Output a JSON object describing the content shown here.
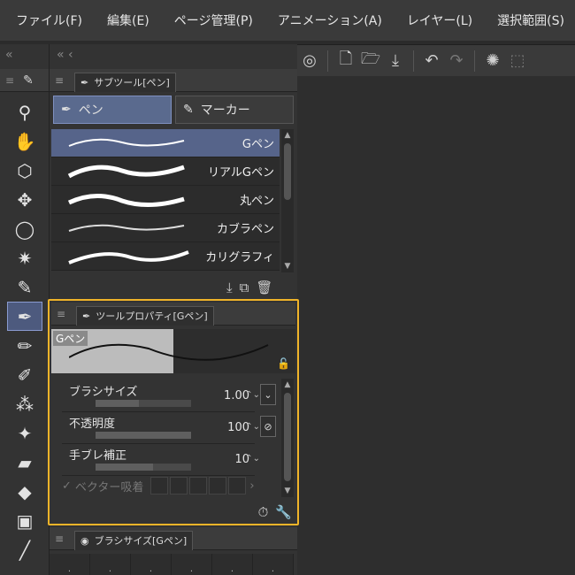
{
  "menu": [
    "ファイル(F)",
    "編集(E)",
    "ページ管理(P)",
    "アニメーション(A)",
    "レイヤー(L)",
    "選択範囲(S)",
    "表"
  ],
  "toolstrip": {
    "collapse": "«",
    "tools": [
      {
        "name": "zoom",
        "glyph": "⚲"
      },
      {
        "name": "hand",
        "glyph": "✋"
      },
      {
        "name": "object",
        "glyph": "⬡"
      },
      {
        "name": "move",
        "glyph": "✥"
      },
      {
        "name": "lasso",
        "glyph": "◯"
      },
      {
        "name": "magic-wand",
        "glyph": "✷"
      },
      {
        "name": "eyedropper",
        "glyph": "✎"
      },
      {
        "name": "pen",
        "glyph": "✒"
      },
      {
        "name": "pencil",
        "glyph": "✏"
      },
      {
        "name": "brush",
        "glyph": "✐"
      },
      {
        "name": "airbrush",
        "glyph": "⁂"
      },
      {
        "name": "decoration",
        "glyph": "✦"
      },
      {
        "name": "eraser",
        "glyph": "▰"
      },
      {
        "name": "fill",
        "glyph": "◆"
      },
      {
        "name": "gradient",
        "glyph": "▣"
      },
      {
        "name": "line",
        "glyph": "╱"
      }
    ]
  },
  "subtool": {
    "collapse": "«  ‹",
    "header": "サブツール[ペン]",
    "groups": [
      "ペン",
      "マーカー"
    ],
    "brushes": [
      "Gペン",
      "リアルGペン",
      "丸ペン",
      "カブラペン",
      "カリグラフィ"
    ]
  },
  "props": {
    "header": "ツールプロパティ[Gペン]",
    "preview_label": "Gペン",
    "rows": [
      {
        "name": "ブラシサイズ",
        "value": "1.00",
        "level": 0.45
      },
      {
        "name": "不透明度",
        "value": "100",
        "level": 1.0
      },
      {
        "name": "手ブレ補正",
        "value": "10",
        "level": 0.6
      }
    ],
    "vector": "ベクター吸着"
  },
  "brushsize": {
    "header": "ブラシサイズ[Gペン]"
  }
}
